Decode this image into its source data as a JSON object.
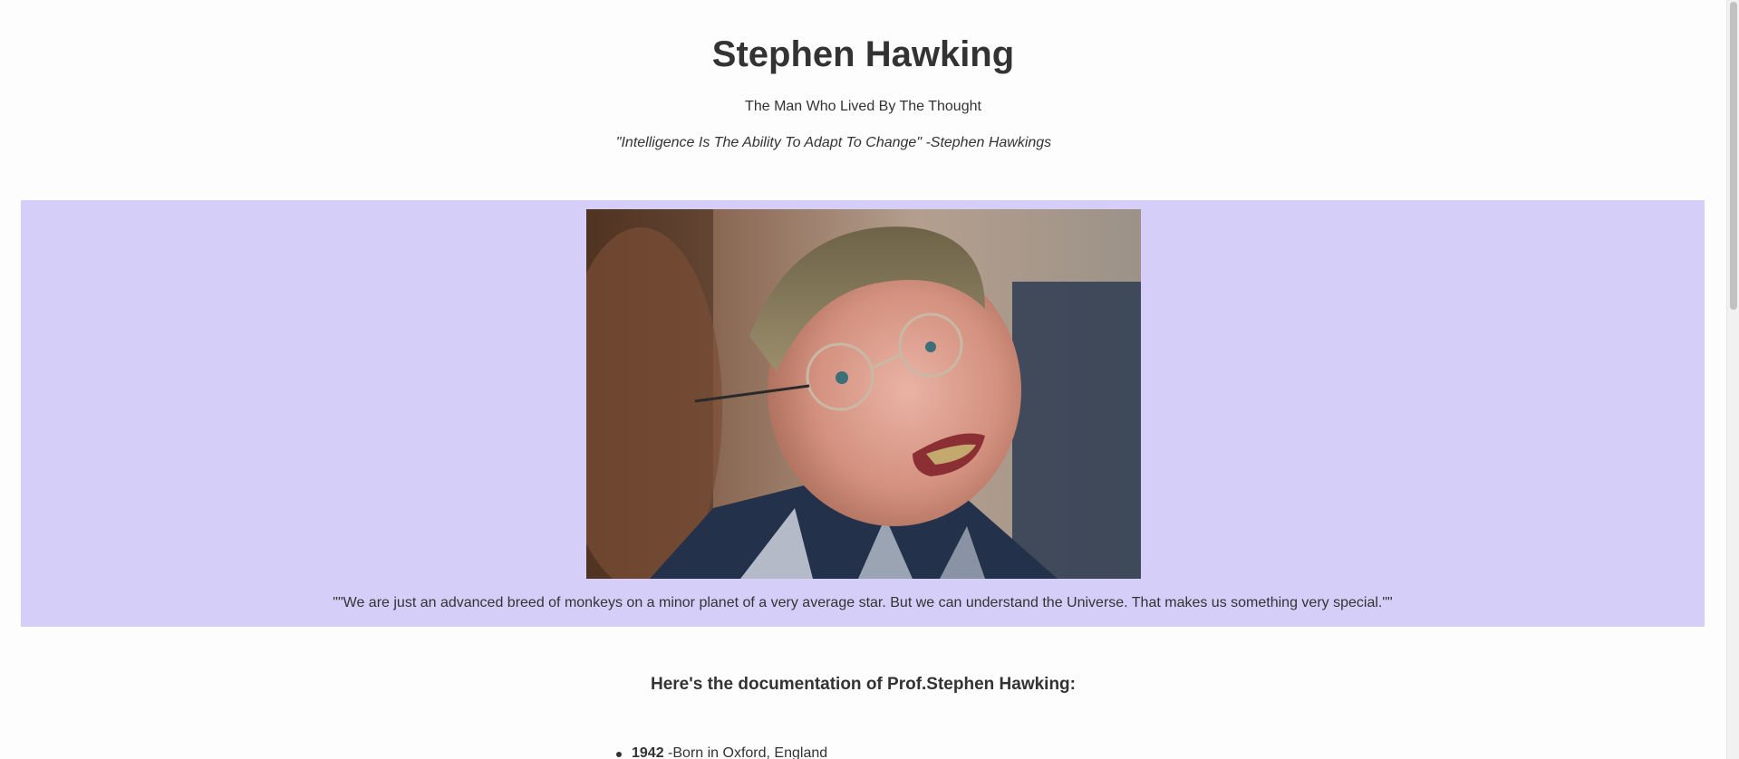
{
  "header": {
    "title": "Stephen Hawking",
    "subtitle": "The Man Who Lived By The Thought",
    "tagline": "\"Intelligence Is The Ability To Adapt To Change\" -Stephen Hawkings"
  },
  "image_section": {
    "photo_icon": "portrait-photo",
    "caption": "\"\"We are just an advanced breed of monkeys on a minor planet of a very average star. But we can understand the Universe. That makes us something very special.\"\""
  },
  "documentation": {
    "heading": "Here's the documentation of Prof.Stephen Hawking:",
    "timeline": [
      {
        "year": "1942",
        "text": " -Born in Oxford, England"
      }
    ]
  },
  "colors": {
    "background": "#fdfdfd",
    "image_section_bg": "#d4cef8",
    "text": "#333333"
  }
}
